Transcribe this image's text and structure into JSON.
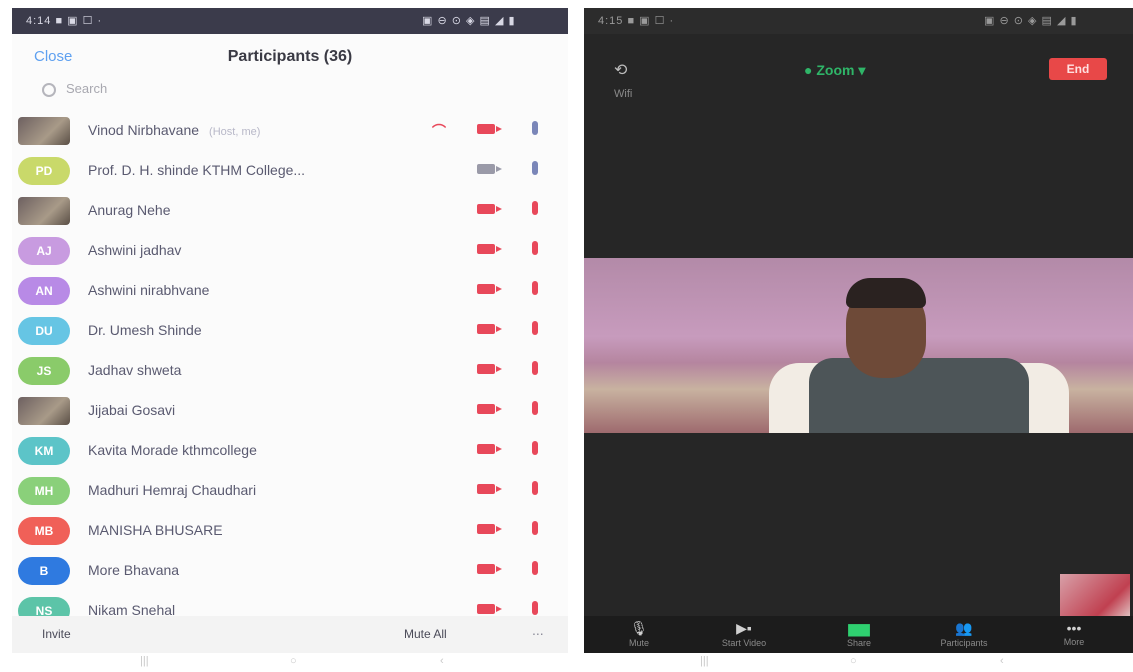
{
  "left_panel": {
    "status_left": "4:14 ■ ▣ ☐ ·",
    "status_right": "▣ ⊖ ⊙ ◈ ▤ ◢ ▮",
    "close_label": "Close",
    "title": "Participants (36)",
    "search_placeholder": "Search",
    "participants": [
      {
        "initials": "",
        "name": "Vinod Nirbhavane",
        "note": "(Host, me)",
        "color": "#9a8a80"
      },
      {
        "initials": "PD",
        "name": "Prof. D. H. shinde KTHM College...",
        "note": "",
        "color": "#c9d96a"
      },
      {
        "initials": "",
        "name": "Anurag Nehe",
        "note": "",
        "color": "#ffffff"
      },
      {
        "initials": "AJ",
        "name": "Ashwini jadhav",
        "note": "",
        "color": "#c89be0"
      },
      {
        "initials": "AN",
        "name": "Ashwini nirabhvane",
        "note": "",
        "color": "#b88ae6"
      },
      {
        "initials": "DU",
        "name": "Dr. Umesh Shinde",
        "note": "",
        "color": "#66c5e4"
      },
      {
        "initials": "JS",
        "name": "Jadhav shweta",
        "note": "",
        "color": "#8acb6a"
      },
      {
        "initials": "",
        "name": "Jijabai Gosavi",
        "note": "",
        "color": "#ffffff"
      },
      {
        "initials": "KM",
        "name": "Kavita Morade kthmcollege",
        "note": "",
        "color": "#5cc4c8"
      },
      {
        "initials": "MH",
        "name": "Madhuri Hemraj Chaudhari",
        "note": "",
        "color": "#8ad07a"
      },
      {
        "initials": "MB",
        "name": "MANISHA BHUSARE",
        "note": "",
        "color": "#f06058"
      },
      {
        "initials": "B",
        "name": "More Bhavana",
        "note": "",
        "color": "#2f7ae0"
      },
      {
        "initials": "NS",
        "name": "Nikam Snehal",
        "note": "",
        "color": "#5cc4a8"
      }
    ],
    "invite_label": "Invite",
    "mute_all_label": "Mute All",
    "more_label": "..."
  },
  "right_panel": {
    "status_left": "4:15 ■ ▣ ☐ ·",
    "status_right": "▣ ⊖ ⊙ ◈ ▤ ◢ ▮",
    "camera_switch_icon": "camera-switch-icon",
    "audio_label": "Wifi",
    "meeting_title": "● Zoom ▾",
    "leave_label": "End",
    "toolbar": [
      {
        "icon": "microphone-icon",
        "glyph": "🎙",
        "label": "Mute"
      },
      {
        "icon": "video-camera-icon",
        "glyph": "▶▪",
        "label": "Start Video"
      },
      {
        "icon": "share-screen-icon",
        "glyph": "▆▆",
        "label": "Share"
      },
      {
        "icon": "participants-icon",
        "glyph": "👥",
        "label": "Participants"
      },
      {
        "icon": "more-icon",
        "glyph": "•••",
        "label": "More"
      }
    ]
  },
  "navbar": [
    "|||",
    "○",
    "‹",
    "|||",
    "○",
    "‹"
  ]
}
